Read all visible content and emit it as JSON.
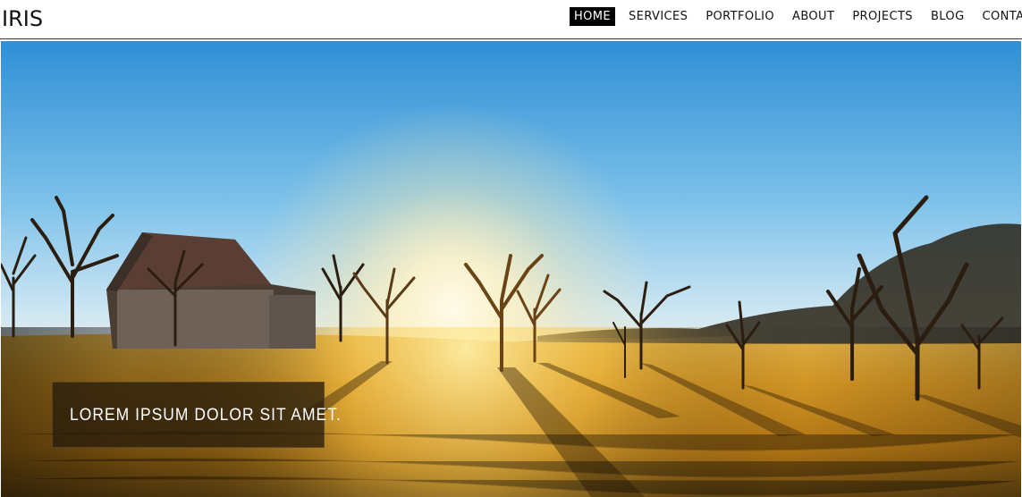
{
  "header": {
    "logo": "IRIS",
    "nav": [
      {
        "label": "HOME",
        "active": true
      },
      {
        "label": "SERVICES",
        "active": false
      },
      {
        "label": "PORTFOLIO",
        "active": false
      },
      {
        "label": "ABOUT",
        "active": false
      },
      {
        "label": "PROJECTS",
        "active": false
      },
      {
        "label": "BLOG",
        "active": false
      },
      {
        "label": "CONTACT",
        "active": false
      }
    ]
  },
  "hero": {
    "caption": "LOREM IPSUM DOLOR SIT AMET."
  },
  "colors": {
    "nav_active_bg": "#000000",
    "sky_top": "#3a9ad8",
    "field": "#d89a2a"
  }
}
